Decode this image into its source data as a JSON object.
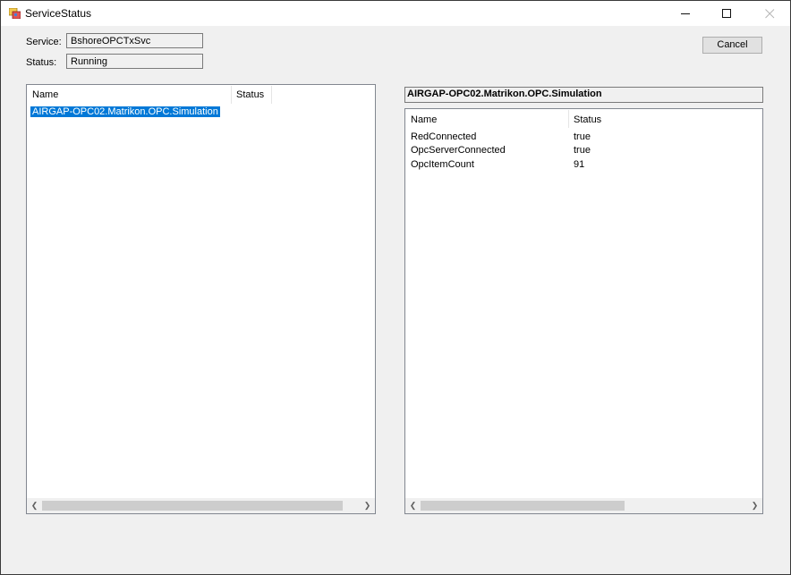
{
  "window": {
    "title": "ServiceStatus"
  },
  "service": {
    "label": "Service:",
    "value": "BshoreOPCTxSvc"
  },
  "status": {
    "label": "Status:",
    "value": "Running"
  },
  "cancel_label": "Cancel",
  "left_list": {
    "columns": [
      "Name",
      "Status"
    ],
    "rows": [
      {
        "name": "AIRGAP-OPC02.Matrikon.OPC.Simulation",
        "status": ""
      }
    ]
  },
  "right_caption": "AIRGAP-OPC02.Matrikon.OPC.Simulation",
  "right_list": {
    "columns": [
      "Name",
      "Status"
    ],
    "rows": [
      {
        "name": "RedConnected",
        "status": "true"
      },
      {
        "name": "OpcServerConnected",
        "status": "true"
      },
      {
        "name": "OpcItemCount",
        "status": "91"
      }
    ]
  },
  "colors": {
    "selection": "#0078d7",
    "accent": "#0078d7"
  }
}
